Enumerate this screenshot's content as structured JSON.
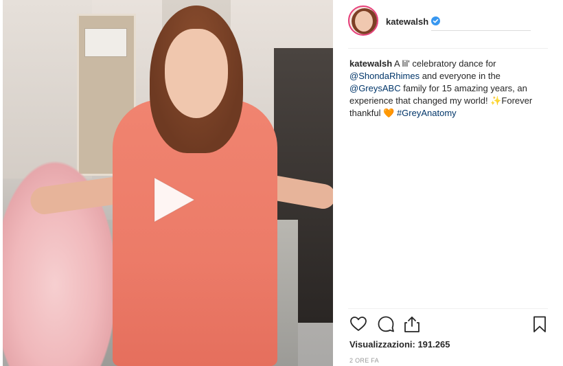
{
  "post": {
    "username": "katewalsh",
    "caption": {
      "user": "katewalsh",
      "text_1": " A lil' celebratory dance for ",
      "mention_1": "@ShondaRhimes",
      "text_2": " and everyone in the ",
      "mention_2": "@GreysABC",
      "text_3": " family for 15 amazing years, an experience that changed my world! ",
      "emoji_1": "✨",
      "text_4": "Forever thankful ",
      "emoji_2": "🧡",
      "hashtag": " #GreyAnatomy"
    },
    "views": "Visualizzazioni: 191.265",
    "time": "2 ORE FA",
    "icons": {
      "play": "play-icon",
      "like": "heart-icon",
      "comment": "comment-icon",
      "share": "share-icon",
      "save": "bookmark-icon",
      "verified": "verified-badge-icon"
    },
    "colors": {
      "link": "#003569",
      "verified": "#3897f0",
      "avatar_ring": "#e63f7a",
      "text": "#262626",
      "muted": "#999999"
    }
  }
}
